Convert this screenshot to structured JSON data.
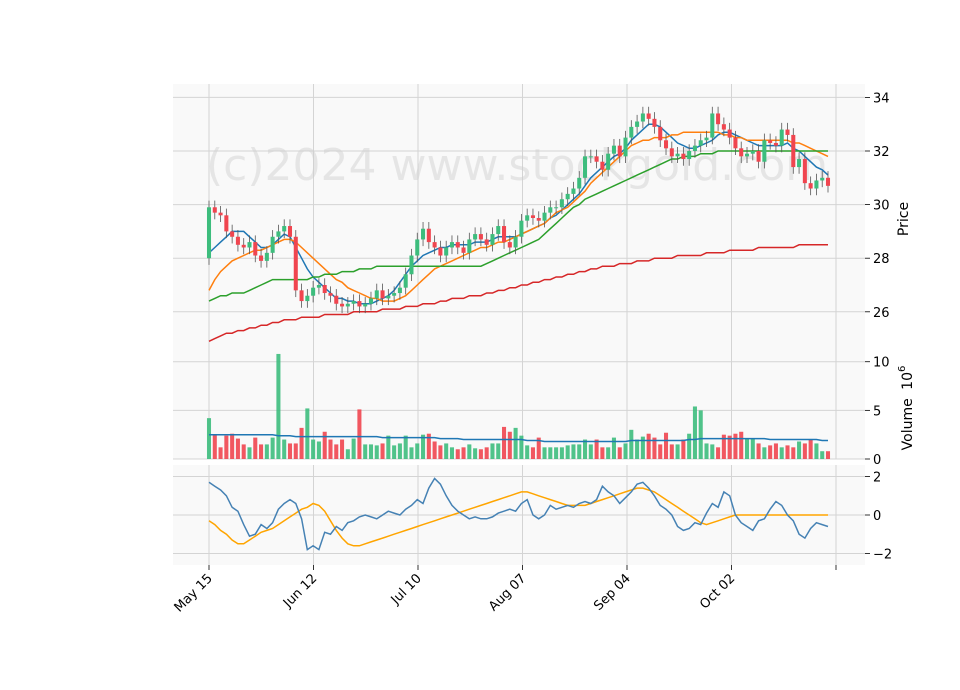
{
  "watermark": "(c)2024 www.stockgold.com",
  "colors": {
    "up": "#3dbd7d",
    "down": "#f0454f",
    "ma_blue": "#1f77b4",
    "ma_orange": "#ff7f0e",
    "ma_green": "#2ca02c",
    "ma_red": "#d62728",
    "vol_ma": "#1f77b4",
    "osc_fast": "#4682b4",
    "osc_slow": "#ffa500"
  },
  "chart_data": {
    "type": "candlestick",
    "x_tick_labels": [
      "May 15",
      "Jun 12",
      "Jul 10",
      "Aug 07",
      "Sep 04",
      "Oct 02",
      ""
    ],
    "price_panel": {
      "ylabel": "Price",
      "yticks": [
        26,
        28,
        30,
        32,
        34
      ],
      "ylim": [
        24.5,
        34.5
      ],
      "grid": true,
      "ohlc_close": [
        29.9,
        29.7,
        29.6,
        29.0,
        28.8,
        28.5,
        28.4,
        28.6,
        28.1,
        27.9,
        28.2,
        28.8,
        29.0,
        29.2,
        28.8,
        26.8,
        26.4,
        26.6,
        26.9,
        27.0,
        26.7,
        26.6,
        26.3,
        26.2,
        26.3,
        26.4,
        26.2,
        26.3,
        26.5,
        26.8,
        26.5,
        26.6,
        26.7,
        26.9,
        27.4,
        28.1,
        28.7,
        29.1,
        28.6,
        28.4,
        28.1,
        28.4,
        28.6,
        28.4,
        28.2,
        28.7,
        28.9,
        28.7,
        28.5,
        28.9,
        29.2,
        28.6,
        28.4,
        28.8,
        29.4,
        29.6,
        29.5,
        29.4,
        29.7,
        29.9,
        29.9,
        30.2,
        30.4,
        30.6,
        31.0,
        31.8,
        31.8,
        31.6,
        31.3,
        31.9,
        32.2,
        31.8,
        32.5,
        32.9,
        33.1,
        33.4,
        33.2,
        32.9,
        32.4,
        32.1,
        31.8,
        31.9,
        31.7,
        32.0,
        32.2,
        32.4,
        32.5,
        33.4,
        33.0,
        32.8,
        32.5,
        32.1,
        31.8,
        31.9,
        32.0,
        31.6,
        32.4,
        32.3,
        32.2,
        32.8,
        32.6,
        31.4,
        31.7,
        30.8,
        30.6,
        30.9,
        31.0,
        30.7
      ],
      "ma_series": [
        {
          "values": [
            28.2,
            28.4,
            28.6,
            28.8,
            29.0,
            29.0,
            29.0,
            28.8,
            28.6,
            28.4,
            28.4,
            28.5,
            28.7,
            28.9,
            28.8,
            28.4,
            28.0,
            27.6,
            27.3,
            27.1,
            26.9,
            26.7,
            26.5,
            26.5,
            26.4,
            26.4,
            26.3,
            26.3,
            26.3,
            26.4,
            26.5,
            26.6,
            26.8,
            27.1,
            27.4,
            27.7,
            27.9,
            28.1,
            28.2,
            28.3,
            28.4,
            28.4,
            28.5,
            28.5,
            28.5,
            28.5,
            28.6,
            28.6,
            28.6,
            28.7,
            28.8,
            28.8,
            28.8,
            28.8,
            28.9,
            29.0,
            29.1,
            29.2,
            29.3,
            29.5,
            29.6,
            29.8,
            30.0,
            30.2,
            30.4,
            30.7,
            31.0,
            31.2,
            31.4,
            31.6,
            31.8,
            31.9,
            32.1,
            32.4,
            32.6,
            32.8,
            33.0,
            33.0,
            32.9,
            32.7,
            32.5,
            32.3,
            32.2,
            32.1,
            32.1,
            32.2,
            32.3,
            32.4,
            32.6,
            32.7,
            32.7,
            32.6,
            32.5,
            32.4,
            32.3,
            32.2,
            32.2,
            32.2,
            32.2,
            32.2,
            32.3,
            32.1,
            32.0,
            31.8,
            31.6,
            31.4,
            31.3,
            31.1
          ]
        },
        {
          "values": [
            26.8,
            27.2,
            27.5,
            27.7,
            27.9,
            28.0,
            28.1,
            28.2,
            28.3,
            28.3,
            28.4,
            28.5,
            28.6,
            28.7,
            28.7,
            28.6,
            28.4,
            28.2,
            28.0,
            27.8,
            27.6,
            27.4,
            27.2,
            27.1,
            26.9,
            26.8,
            26.7,
            26.6,
            26.5,
            26.5,
            26.4,
            26.4,
            26.4,
            26.5,
            26.6,
            26.8,
            27.0,
            27.2,
            27.4,
            27.6,
            27.7,
            27.8,
            27.9,
            28.0,
            28.1,
            28.2,
            28.3,
            28.4,
            28.4,
            28.5,
            28.6,
            28.6,
            28.7,
            28.8,
            28.9,
            29.0,
            29.1,
            29.2,
            29.3,
            29.5,
            29.7,
            29.8,
            29.9,
            30.1,
            30.3,
            30.5,
            30.8,
            31.0,
            31.2,
            31.4,
            31.6,
            31.8,
            32.0,
            32.2,
            32.3,
            32.4,
            32.4,
            32.5,
            32.5,
            32.5,
            32.6,
            32.6,
            32.7,
            32.7,
            32.7,
            32.7,
            32.7,
            32.7,
            32.7,
            32.6,
            32.6,
            32.5,
            32.5,
            32.4,
            32.4,
            32.4,
            32.4,
            32.4,
            32.4,
            32.4,
            32.4,
            32.3,
            32.3,
            32.2,
            32.1,
            32.0,
            31.9,
            31.8
          ]
        },
        {
          "values": [
            26.4,
            26.5,
            26.6,
            26.6,
            26.7,
            26.7,
            26.7,
            26.8,
            26.9,
            27.0,
            27.1,
            27.2,
            27.2,
            27.2,
            27.2,
            27.2,
            27.2,
            27.2,
            27.3,
            27.3,
            27.4,
            27.4,
            27.4,
            27.5,
            27.5,
            27.5,
            27.6,
            27.6,
            27.6,
            27.7,
            27.7,
            27.7,
            27.7,
            27.7,
            27.7,
            27.7,
            27.7,
            27.7,
            27.7,
            27.7,
            27.7,
            27.7,
            27.7,
            27.7,
            27.7,
            27.7,
            27.7,
            27.7,
            27.8,
            27.9,
            28.0,
            28.1,
            28.2,
            28.3,
            28.4,
            28.5,
            28.6,
            28.7,
            28.9,
            29.1,
            29.3,
            29.5,
            29.7,
            29.9,
            30.0,
            30.2,
            30.3,
            30.4,
            30.5,
            30.6,
            30.7,
            30.8,
            30.9,
            31.0,
            31.1,
            31.2,
            31.3,
            31.4,
            31.5,
            31.6,
            31.7,
            31.7,
            31.8,
            31.8,
            31.8,
            31.9,
            31.9,
            31.9,
            32.0,
            32.0,
            32.0,
            32.0,
            32.0,
            32.0,
            32.0,
            32.0,
            32.0,
            32.0,
            32.0,
            32.0,
            32.0,
            32.0,
            32.0,
            32.0,
            32.0,
            32.0,
            32.0,
            32.0
          ]
        },
        {
          "values": [
            24.9,
            25.0,
            25.1,
            25.2,
            25.2,
            25.3,
            25.3,
            25.4,
            25.4,
            25.5,
            25.5,
            25.6,
            25.6,
            25.7,
            25.7,
            25.7,
            25.8,
            25.8,
            25.8,
            25.8,
            25.9,
            25.9,
            25.9,
            25.9,
            25.9,
            26.0,
            26.0,
            26.0,
            26.0,
            26.0,
            26.1,
            26.1,
            26.1,
            26.1,
            26.2,
            26.2,
            26.2,
            26.3,
            26.3,
            26.3,
            26.4,
            26.4,
            26.5,
            26.5,
            26.5,
            26.6,
            26.6,
            26.6,
            26.7,
            26.7,
            26.8,
            26.8,
            26.9,
            26.9,
            27.0,
            27.0,
            27.1,
            27.1,
            27.2,
            27.2,
            27.3,
            27.3,
            27.4,
            27.4,
            27.5,
            27.5,
            27.6,
            27.6,
            27.7,
            27.7,
            27.7,
            27.8,
            27.8,
            27.8,
            27.9,
            27.9,
            27.9,
            28.0,
            28.0,
            28.0,
            28.0,
            28.1,
            28.1,
            28.1,
            28.1,
            28.1,
            28.2,
            28.2,
            28.2,
            28.2,
            28.3,
            28.3,
            28.3,
            28.3,
            28.3,
            28.4,
            28.4,
            28.4,
            28.4,
            28.4,
            28.4,
            28.4,
            28.5,
            28.5,
            28.5,
            28.5,
            28.5,
            28.5
          ]
        }
      ]
    },
    "volume_panel": {
      "ylabel": "Volume",
      "unit": "10",
      "unit_exponent": "6",
      "yticks": [
        0,
        5,
        10
      ],
      "ylim": [
        0,
        11
      ],
      "volumes": [
        4.2,
        2.5,
        1.2,
        2.4,
        2.6,
        2.1,
        1.5,
        1.2,
        2.2,
        1.5,
        1.5,
        2.2,
        10.8,
        2.0,
        1.6,
        1.6,
        3.2,
        5.2,
        2.0,
        1.8,
        2.8,
        2.0,
        1.5,
        2.0,
        1.0,
        2.1,
        5.1,
        1.5,
        1.5,
        1.4,
        1.6,
        2.4,
        1.4,
        1.6,
        2.4,
        1.2,
        1.6,
        2.5,
        2.6,
        1.8,
        1.4,
        1.6,
        1.2,
        1.0,
        1.2,
        1.5,
        1.1,
        1.0,
        1.2,
        1.6,
        1.6,
        3.3,
        2.8,
        3.2,
        2.4,
        1.4,
        1.2,
        2.2,
        1.2,
        1.2,
        1.2,
        1.2,
        1.4,
        1.5,
        1.5,
        2.0,
        1.5,
        2.0,
        1.2,
        1.2,
        2.2,
        1.2,
        1.6,
        3.0,
        2.0,
        2.3,
        2.6,
        2.2,
        1.5,
        2.7,
        1.5,
        1.5,
        2.0,
        2.6,
        5.4,
        5.0,
        1.6,
        1.5,
        1.2,
        2.5,
        2.4,
        2.6,
        2.8,
        2.1,
        2.1,
        1.6,
        1.2,
        1.4,
        1.6,
        1.2,
        1.4,
        1.2,
        1.8,
        1.6,
        2.0,
        1.6,
        0.8,
        0.8
      ],
      "ma_values": [
        2.5,
        2.5,
        2.5,
        2.5,
        2.5,
        2.5,
        2.5,
        2.5,
        2.5,
        2.5,
        2.5,
        2.5,
        2.4,
        2.4,
        2.4,
        2.3,
        2.3,
        2.3,
        2.3,
        2.3,
        2.3,
        2.3,
        2.3,
        2.3,
        2.3,
        2.3,
        2.3,
        2.3,
        2.3,
        2.3,
        2.2,
        2.2,
        2.2,
        2.2,
        2.2,
        2.2,
        2.2,
        2.2,
        2.2,
        2.2,
        2.1,
        2.1,
        2.1,
        2.1,
        2.0,
        2.0,
        2.0,
        2.0,
        2.0,
        2.0,
        2.0,
        2.0,
        2.0,
        2.0,
        2.0,
        1.9,
        1.9,
        1.9,
        1.8,
        1.8,
        1.8,
        1.8,
        1.8,
        1.8,
        1.8,
        1.8,
        1.8,
        1.8,
        1.8,
        1.8,
        1.8,
        1.8,
        1.8,
        1.9,
        1.9,
        1.9,
        1.9,
        1.9,
        1.9,
        1.9,
        1.9,
        1.9,
        1.9,
        2.0,
        2.0,
        2.1,
        2.1,
        2.1,
        2.1,
        2.1,
        2.1,
        2.1,
        2.1,
        2.1,
        2.1,
        2.1,
        2.1,
        2.0,
        2.0,
        2.0,
        2.0,
        2.0,
        2.0,
        2.0,
        2.0,
        2.0,
        1.9,
        1.9
      ]
    },
    "oscillator_panel": {
      "yticks": [
        -2,
        0,
        2
      ],
      "ylim": [
        -2.6,
        2.6
      ],
      "fast": [
        1.7,
        1.5,
        1.3,
        1.0,
        0.4,
        0.2,
        -0.5,
        -1.1,
        -1.0,
        -0.5,
        -0.7,
        -0.4,
        0.3,
        0.6,
        0.8,
        0.6,
        -0.2,
        -1.8,
        -1.6,
        -1.8,
        -0.9,
        -1.0,
        -0.6,
        -0.8,
        -0.4,
        -0.3,
        -0.1,
        0.0,
        -0.1,
        -0.2,
        0.0,
        0.2,
        0.1,
        0.0,
        0.3,
        0.5,
        0.8,
        0.6,
        1.4,
        1.9,
        1.6,
        1.0,
        0.5,
        0.2,
        0.0,
        -0.2,
        -0.1,
        -0.2,
        -0.2,
        -0.1,
        0.1,
        0.2,
        0.3,
        0.2,
        0.6,
        0.8,
        0.0,
        -0.2,
        0.0,
        0.5,
        0.3,
        0.4,
        0.5,
        0.4,
        0.6,
        0.7,
        0.6,
        0.8,
        1.5,
        1.2,
        1.0,
        0.6,
        0.9,
        1.2,
        1.6,
        1.7,
        1.4,
        1.0,
        0.5,
        0.3,
        0.0,
        -0.6,
        -0.8,
        -0.7,
        -0.4,
        -0.5,
        0.1,
        0.6,
        0.4,
        1.2,
        1.0,
        0.0,
        -0.4,
        -0.6,
        -0.8,
        -0.3,
        -0.2,
        0.3,
        0.7,
        0.5,
        0.0,
        -0.3,
        -1.0,
        -1.2,
        -0.7,
        -0.4,
        -0.5,
        -0.6
      ],
      "slow": [
        -0.3,
        -0.5,
        -0.8,
        -1.0,
        -1.3,
        -1.5,
        -1.5,
        -1.3,
        -1.1,
        -0.9,
        -0.8,
        -0.7,
        -0.5,
        -0.3,
        -0.1,
        0.1,
        0.3,
        0.4,
        0.6,
        0.5,
        0.2,
        -0.3,
        -0.8,
        -1.2,
        -1.5,
        -1.6,
        -1.6,
        -1.5,
        -1.4,
        -1.3,
        -1.2,
        -1.1,
        -1.0,
        -0.9,
        -0.8,
        -0.7,
        -0.6,
        -0.5,
        -0.4,
        -0.3,
        -0.2,
        -0.1,
        0.0,
        0.1,
        0.2,
        0.3,
        0.4,
        0.5,
        0.6,
        0.7,
        0.8,
        0.9,
        1.0,
        1.1,
        1.2,
        1.2,
        1.1,
        1.0,
        0.9,
        0.8,
        0.7,
        0.6,
        0.5,
        0.5,
        0.5,
        0.5,
        0.6,
        0.7,
        0.8,
        0.9,
        1.0,
        1.1,
        1.2,
        1.3,
        1.4,
        1.4,
        1.3,
        1.2,
        1.0,
        0.8,
        0.6,
        0.4,
        0.2,
        0.0,
        -0.2,
        -0.4,
        -0.5,
        -0.4,
        -0.3,
        -0.2,
        -0.1,
        0.0,
        0.0,
        0.0,
        0.0,
        0.0,
        0.0,
        0.0,
        0.0,
        0.0,
        0.0,
        0.0,
        0.0,
        0.0,
        0.0,
        0.0,
        0.0,
        0.0
      ]
    }
  }
}
